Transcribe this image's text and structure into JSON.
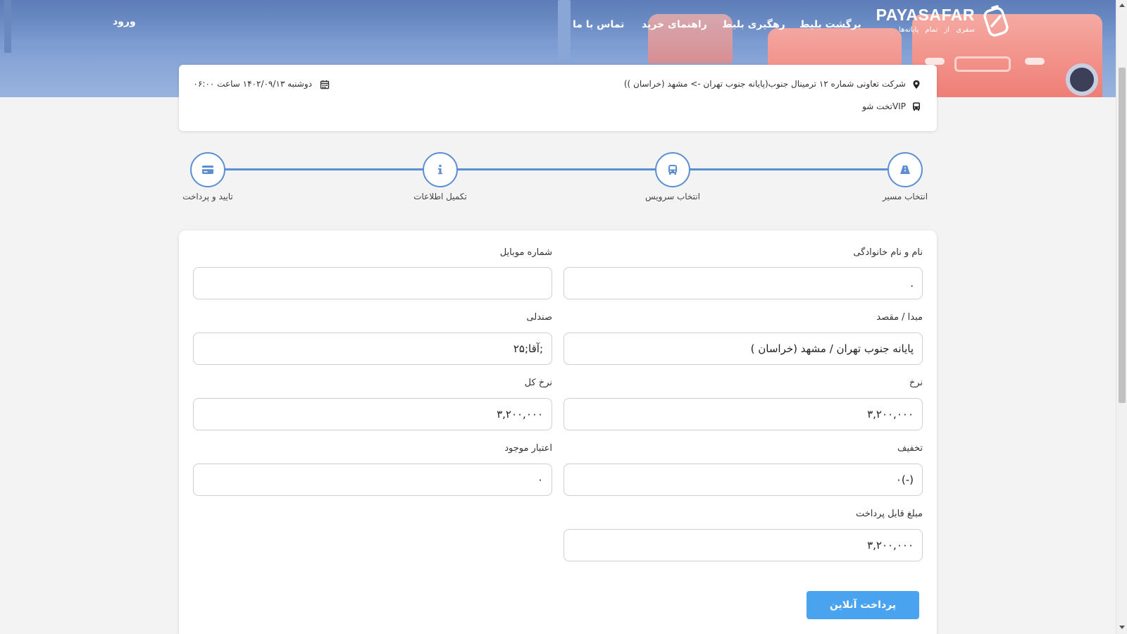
{
  "nav": {
    "login": "ورود",
    "items": [
      "برگشت بلیط",
      "رهگیری بلیط",
      "راهنمای خرید",
      "تماس با ما"
    ],
    "brand": {
      "name": "PAYASAFAR",
      "tagline": "سفری از تمام پایانه‌ها"
    }
  },
  "trip": {
    "route": "شرکت تعاونی شماره ۱۲ ترمینال جنوب(پایانه جنوب تهران -> مشهد (خراسان ))",
    "datetime": "دوشنبه ۱۴۰۲/۰۹/۱۳ ساعت ۰۶:۰۰",
    "bus_type": "VIPتخت شو",
    "icons": [
      "map-pin-icon",
      "calendar-icon",
      "bus-icon"
    ]
  },
  "steps": [
    {
      "label": "انتخاب مسیر",
      "icon": "road-icon"
    },
    {
      "label": "انتخاب سرویس",
      "icon": "bus-icon"
    },
    {
      "label": "تکمیل اطلاعات",
      "icon": "info-icon"
    },
    {
      "label": "تایید و پرداخت",
      "icon": "credit-card-icon"
    }
  ],
  "form": {
    "full_name": {
      "label": "نام و نام خانوادگی",
      "value": "."
    },
    "mobile": {
      "label": "شماره موبایل",
      "value": ""
    },
    "origin_dest": {
      "label": "مبدا / مقصد",
      "value": "پایانه جنوب تهران / مشهد (خراسان )"
    },
    "seat": {
      "label": "صندلی",
      "value": ";آقا;۲۵"
    },
    "fare": {
      "label": "نرخ",
      "value": "۳,۲۰۰,۰۰۰"
    },
    "total_fare": {
      "label": "نرخ کل",
      "value": "۳,۲۰۰,۰۰۰"
    },
    "discount": {
      "label": "تخفیف",
      "value": "(-)۰"
    },
    "credit": {
      "label": "اعتبار موجود",
      "value": "۰"
    },
    "payable": {
      "label": "مبلغ قابل پرداخت",
      "value": "۳,۲۰۰,۰۰۰"
    },
    "pay_button": "پرداخت آنلاین"
  },
  "colors": {
    "accent": "#4aa3ee",
    "step": "#5b8ed3",
    "bus": "#ef7f78"
  }
}
